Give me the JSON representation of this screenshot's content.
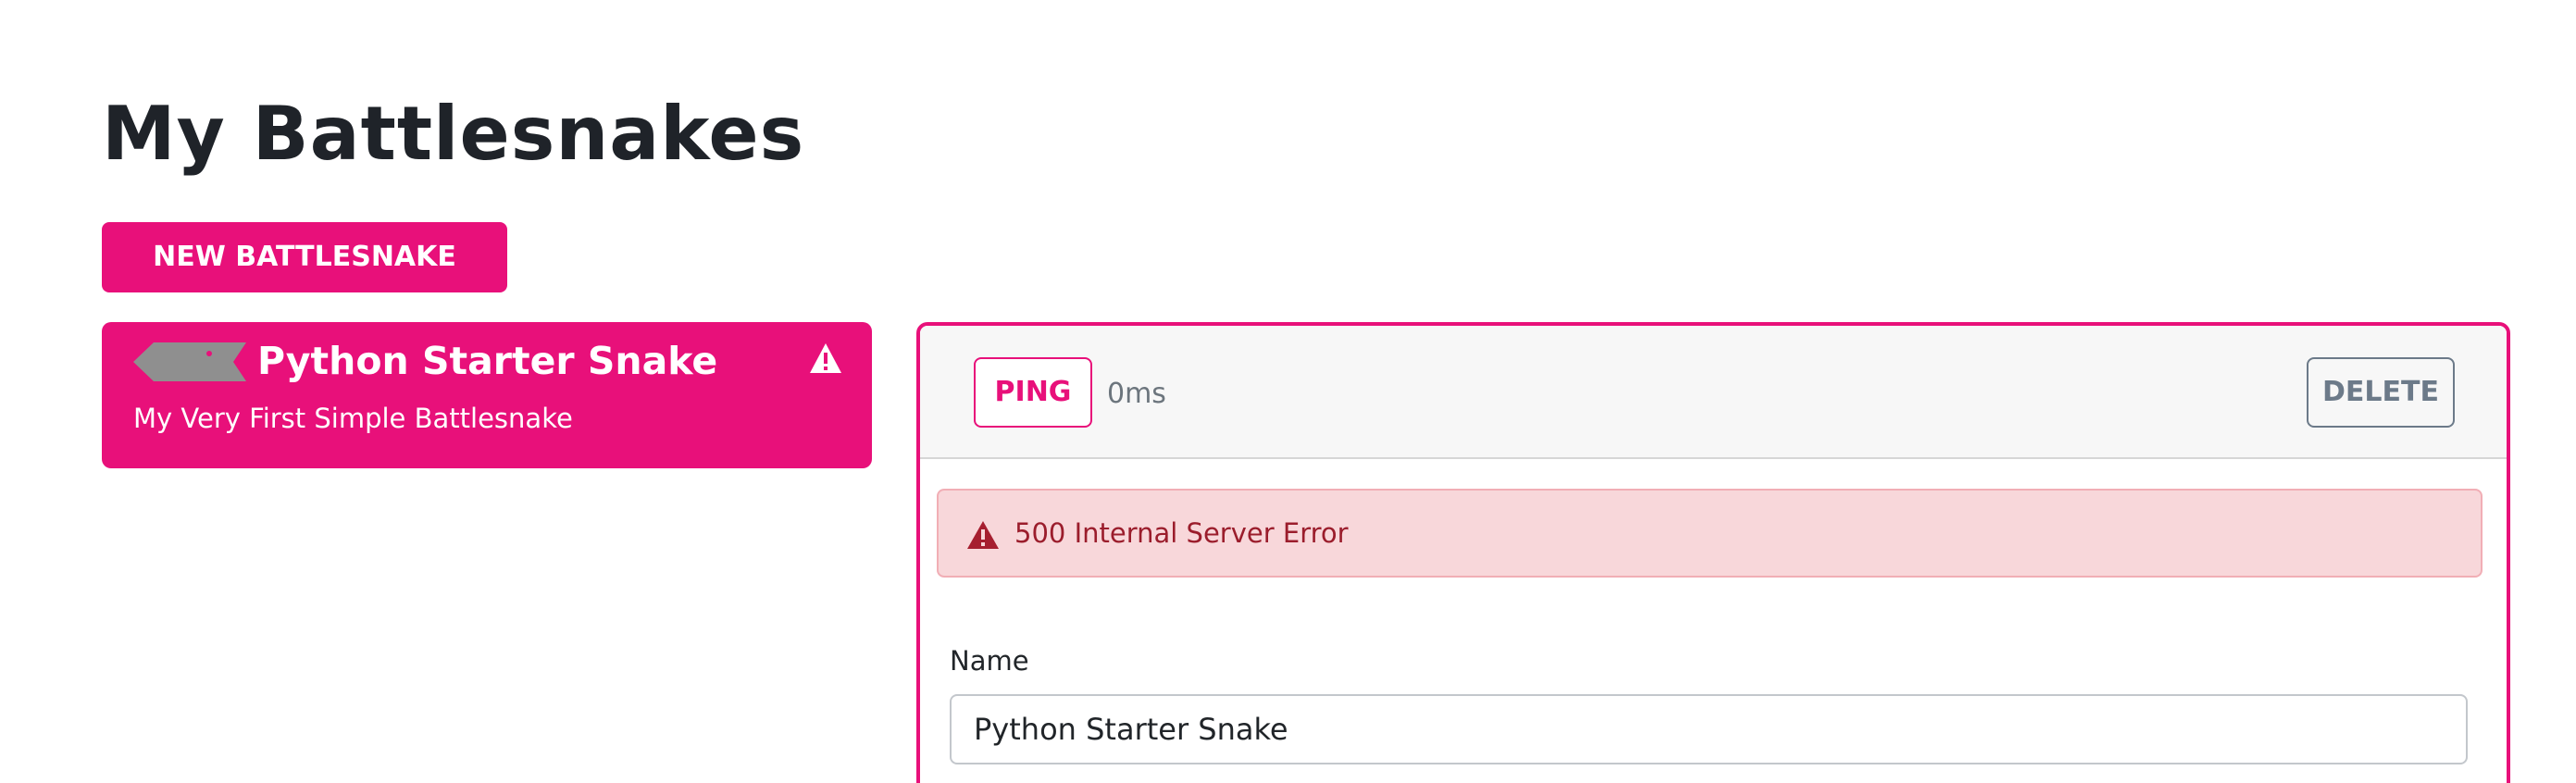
{
  "page": {
    "title": "My Battlesnakes"
  },
  "actions": {
    "new_label": "NEW BATTLESNAKE"
  },
  "snake_list": [
    {
      "name": "Python Starter Snake",
      "description": "My Very First Simple Battlesnake",
      "status_icon": "warning-icon",
      "head_icon": "snake-head-icon",
      "color": "#e8107a"
    }
  ],
  "detail": {
    "ping_label": "PING",
    "latency": "0ms",
    "delete_label": "DELETE",
    "error_message": "500 Internal Server Error",
    "error_icon": "warning-icon",
    "name_label": "Name",
    "name_value": "Python Starter Snake"
  },
  "colors": {
    "accent": "#e8107a",
    "danger_bg": "#f8d7da",
    "danger_text": "#9b1d2c",
    "muted": "#6c7a89"
  }
}
